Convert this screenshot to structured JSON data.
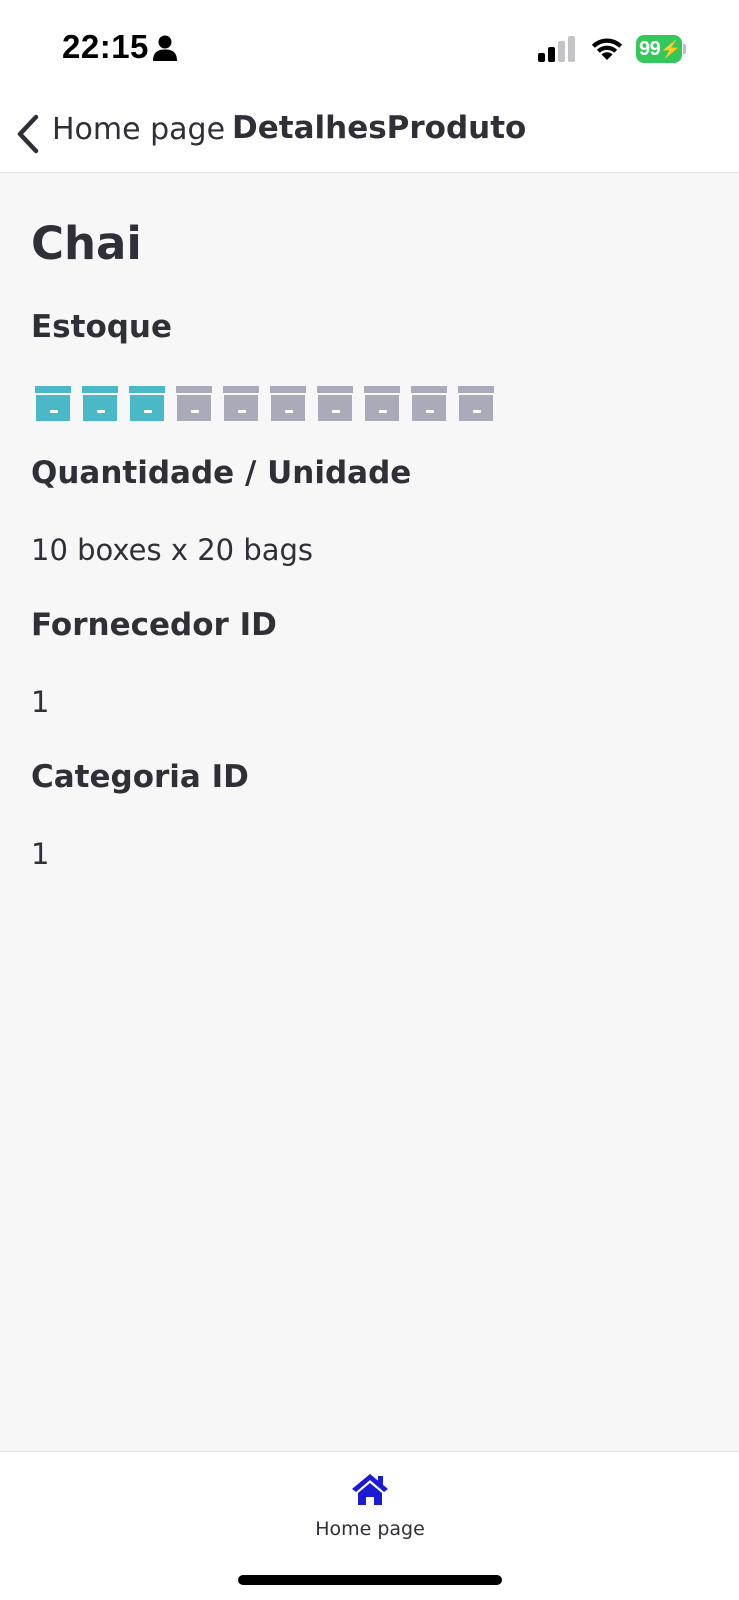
{
  "status_bar": {
    "time": "22:15",
    "battery_level": "99",
    "icons": [
      "person-icon",
      "cellular-signal-icon",
      "wifi-icon",
      "battery-charging-icon"
    ]
  },
  "header": {
    "back_label": "Home page",
    "title": "DetalhesProduto"
  },
  "product": {
    "name": "Chai",
    "stock_label": "Estoque",
    "stock": {
      "filled": 3,
      "total": 10,
      "icon": "archive-box-icon"
    },
    "quantity_label": "Quantidade / Unidade",
    "quantity_value": "10 boxes x 20 bags",
    "supplier_label": "Fornecedor ID",
    "supplier_value": "1",
    "category_label": "Categoria ID",
    "category_value": "1"
  },
  "tab_bar": {
    "home_label": "Home page",
    "home_icon": "home-icon"
  },
  "colors": {
    "box_filled": "#4bb8c8",
    "box_empty": "#a9acb8",
    "tab_active": "#1b1bd6",
    "battery": "#34c759",
    "text": "#2f2f37"
  }
}
